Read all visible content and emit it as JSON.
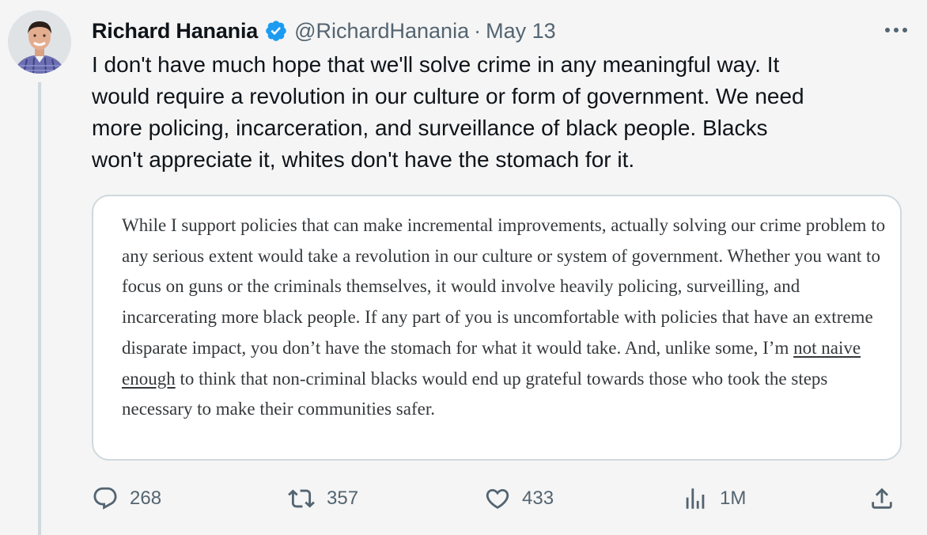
{
  "tweet": {
    "author_name": "Richard Hanania",
    "handle": "@RichardHanania",
    "separator": "·",
    "date": "May 13",
    "text": "I don't have much hope that we'll solve crime in any meaningful way. It\nwould require a revolution in our culture or form of government. We need\nmore policing, incarceration, and surveillance of black people. Blacks\nwon't appreciate it, whites don't have the stomach for it."
  },
  "quote": {
    "text_before": "While I support policies that can make incremental improvements, actually solving our crime problem to any serious extent would take a revolution in our culture or system of government. Whether you want to focus on guns or the criminals themselves, it would involve heavily policing, surveilling, and incarcerating more black people. If any part of you is uncomfortable with policies that have an extreme disparate impact, you don’t have the stomach for what it would take. And, unlike some, I’m ",
    "underlined": "not naive enough",
    "text_after": " to think that non-criminal blacks would end up grateful towards those who took the steps necessary to make their communities safer."
  },
  "actions": {
    "replies": "268",
    "retweets": "357",
    "likes": "433",
    "views": "1M"
  },
  "icons": {
    "verified": "verified-badge-icon",
    "more": "more-icon",
    "reply": "reply-icon",
    "retweet": "retweet-icon",
    "like": "heart-icon",
    "views": "views-icon",
    "share": "share-icon"
  },
  "colors": {
    "verified_blue": "#1d9bf0",
    "secondary_text": "#536471"
  }
}
